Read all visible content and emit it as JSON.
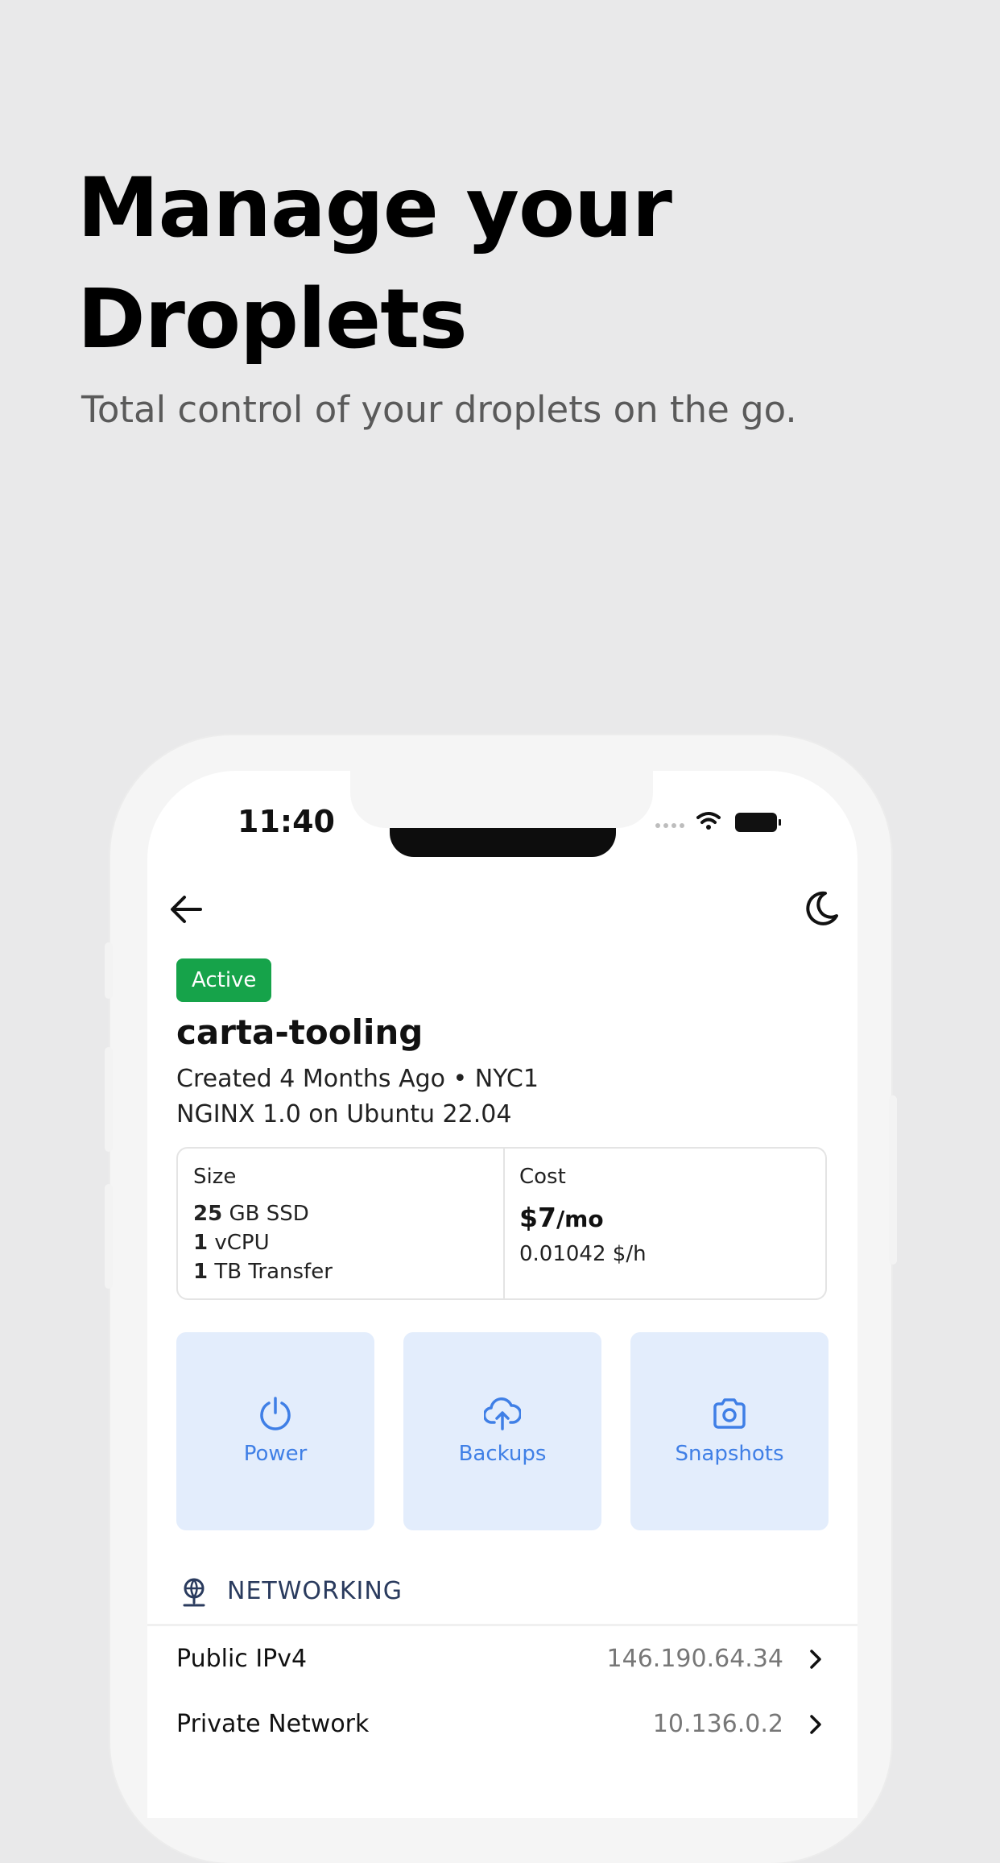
{
  "hero": {
    "title": "Manage your Droplets",
    "subtitle": "Total control of your droplets on the go."
  },
  "status_bar": {
    "time": "11:40",
    "icons": [
      "signal-icon",
      "wifi-icon",
      "battery-icon"
    ]
  },
  "nav": {
    "back_icon": "arrow-left-icon",
    "theme_icon": "moon-icon"
  },
  "droplet": {
    "status": "Active",
    "status_color": "#16a34a",
    "name": "carta-tooling",
    "created_line": "Created 4 Months Ago • NYC1",
    "image_line": "NGINX 1.0 on Ubuntu 22.04"
  },
  "specs": {
    "size_label": "Size",
    "disk_value": "25",
    "disk_unit": "GB SSD",
    "cpu_value": "1",
    "cpu_unit": "vCPU",
    "transfer_value": "1",
    "transfer_unit": "TB Transfer",
    "cost_label": "Cost",
    "cost_monthly": "$7",
    "cost_monthly_unit": "/mo",
    "cost_hourly": "0.01042 $/h"
  },
  "actions": [
    {
      "label": "Power",
      "icon": "power-icon"
    },
    {
      "label": "Backups",
      "icon": "cloud-upload-icon"
    },
    {
      "label": "Snapshots",
      "icon": "camera-icon"
    }
  ],
  "accent_color": "#3f7fe6",
  "networking": {
    "title": "NETWORKING",
    "icon": "globe-network-icon",
    "rows": [
      {
        "label": "Public IPv4",
        "value": "146.190.64.34"
      },
      {
        "label": "Private Network",
        "value": "10.136.0.2"
      }
    ]
  }
}
